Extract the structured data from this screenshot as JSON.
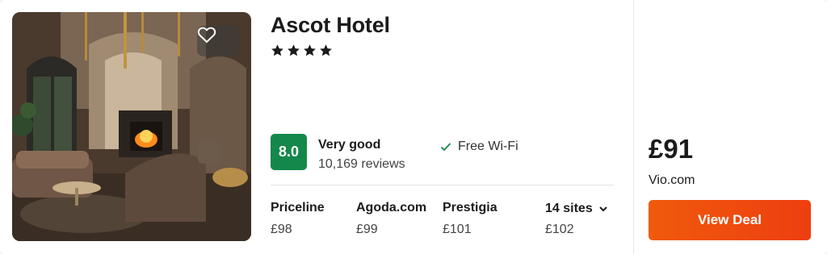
{
  "hotel": {
    "name": "Ascot Hotel",
    "star_rating": 4
  },
  "rating": {
    "score": "8.0",
    "label": "Very good",
    "reviews": "10,169 reviews",
    "color": "#14884a"
  },
  "amenities": [
    {
      "label": "Free Wi-Fi",
      "icon": "check-icon"
    }
  ],
  "providers": [
    {
      "name": "Priceline",
      "price": "£98"
    },
    {
      "name": "Agoda.com",
      "price": "£99"
    },
    {
      "name": "Prestigia",
      "price": "£101"
    }
  ],
  "more_sites": {
    "label": "14 sites",
    "price": "£102",
    "icon": "chevron-down-icon"
  },
  "deal": {
    "price": "£91",
    "site": "Vio.com",
    "button_label": "View Deal",
    "button_color": "#ef4a0e"
  },
  "icons": {
    "favorite": "heart-icon",
    "star": "star-icon"
  }
}
